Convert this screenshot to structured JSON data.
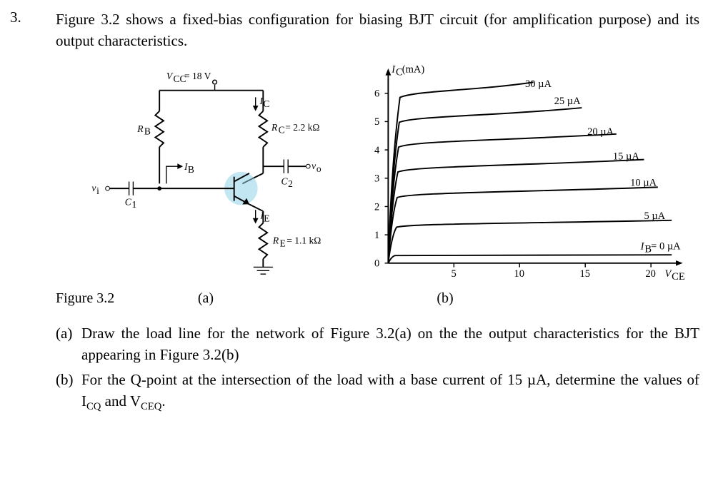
{
  "question_number": "3.",
  "intro": "Figure 3.2 shows a fixed-bias configuration for biasing BJT circuit (for amplification purpose) and its output characteristics.",
  "figure_label": "Figure 3.2",
  "sub_a": "(a)",
  "sub_b": "(b)",
  "circuit": {
    "vcc": "V_{CC} = 18 V",
    "rc": "R_C = 2.2 kΩ",
    "re": "R_E = 1.1 kΩ",
    "rb": "R_B",
    "c1": "C_1",
    "c2": "C_2",
    "ic": "I_C",
    "ie": "I_E",
    "ib": "I_B",
    "vi": "v_i",
    "vo": "v_o"
  },
  "chart_data": {
    "type": "line",
    "title": "",
    "xlabel": "V_{CE}",
    "ylabel": "I_C (mA)",
    "xlim": [
      0,
      22
    ],
    "ylim": [
      0,
      6.5
    ],
    "xticks": [
      0,
      5,
      10,
      15,
      20
    ],
    "yticks": [
      0,
      1,
      2,
      3,
      4,
      5,
      6
    ],
    "series": [
      {
        "name": "I_B = 0 µA",
        "flat_Ic_mA": 0.3
      },
      {
        "name": "5 µA",
        "flat_Ic_mA": 1.4
      },
      {
        "name": "10 µA",
        "flat_Ic_mA": 2.5
      },
      {
        "name": "15 µA",
        "flat_Ic_mA": 3.4
      },
      {
        "name": "20 µA",
        "flat_Ic_mA": 4.3
      },
      {
        "name": "25 µA",
        "flat_Ic_mA": 5.2
      },
      {
        "name": "30 µA",
        "flat_Ic_mA": 6.1
      }
    ],
    "note": "flat_Ic_mA is the approximate collector current on the flat (active-region) part of each curve, read from the plot."
  },
  "parts": {
    "a": {
      "letter": "(a)",
      "text": "Draw the load line for the network of Figure 3.2(a) on the the output characteristics for the BJT appearing in Figure 3.2(b)"
    },
    "b": {
      "letter": "(b)",
      "text": "For the Q-point at the intersection of the load with a base current of 15 µA, determine the values of I_{CQ} and V_{CEQ}."
    }
  }
}
